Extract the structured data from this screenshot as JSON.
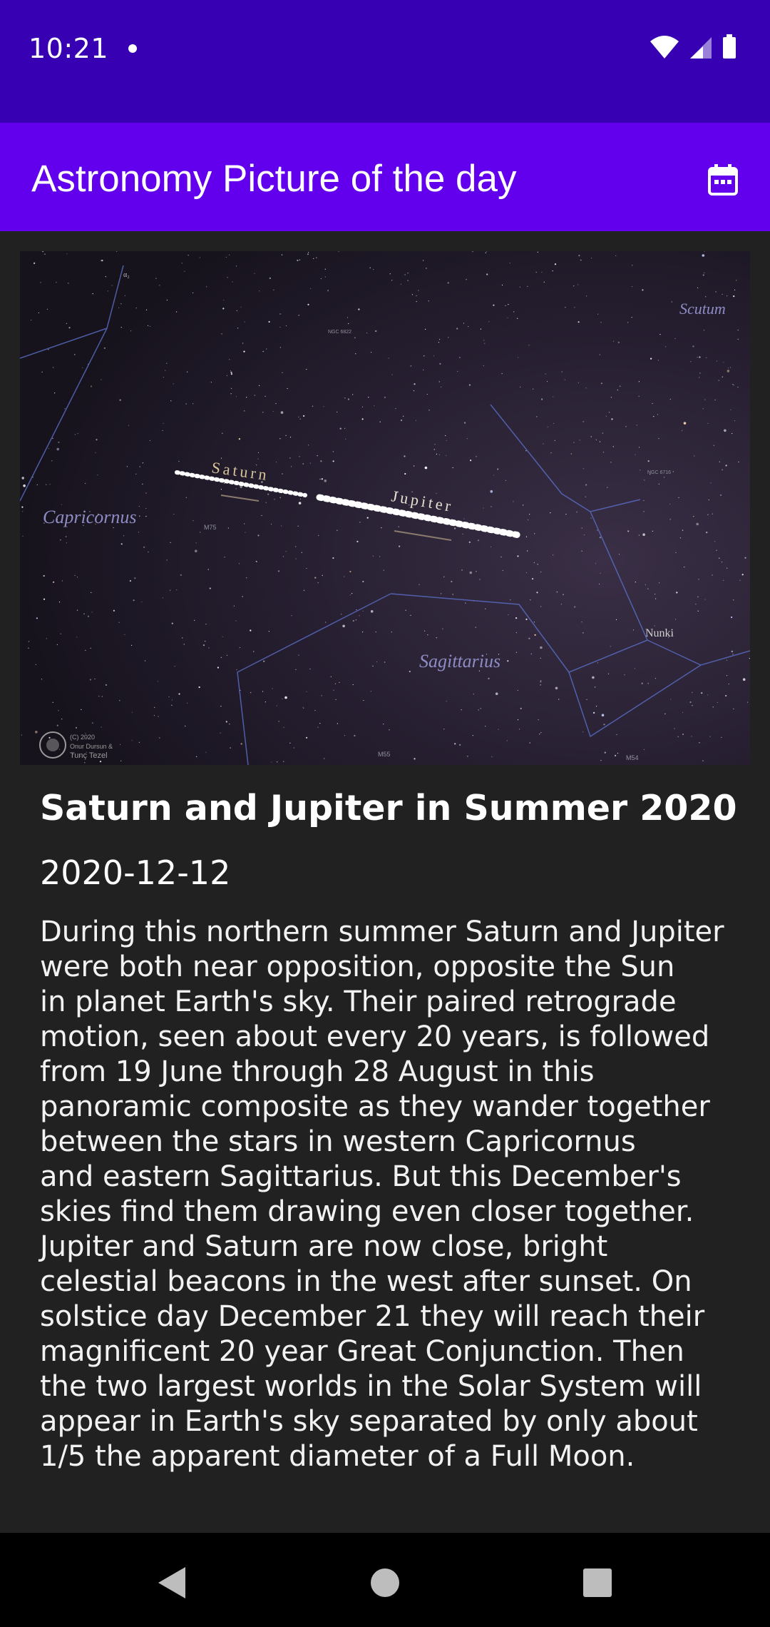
{
  "status_bar": {
    "time": "10:21",
    "icons": [
      "notification-dot-icon",
      "wifi-icon",
      "signal-icon",
      "battery-icon"
    ]
  },
  "app_bar": {
    "title": "Astronomy Picture of the day",
    "action_icon": "calendar-icon"
  },
  "apod": {
    "image_labels": {
      "saturn": "Saturn",
      "jupiter": "Jupiter",
      "capricornus": "Capricornus",
      "sagittarius": "Sagittarius",
      "scutum": "Scutum",
      "nunki": "Nunki",
      "m75": "M75",
      "m55": "M55",
      "m54": "M54",
      "ngc6822": "NGC 6822",
      "ngc6716": "NGC 6716",
      "alpha": "α₂",
      "copyright_1": "(C) 2020",
      "copyright_2": "Onur Dursun &",
      "copyright_3": "Tunç Tezel"
    },
    "title": "Saturn and Jupiter in Summer 2020",
    "date": "2020-12-12",
    "explanation": "During this northern summer Saturn and Jupiter\nwere both near opposition, opposite the Sun\nin planet Earth's sky. Their paired retrograde\nmotion, seen about every 20 years, is followed\nfrom 19 June through 28 August in this\npanoramic composite as they wander together\nbetween the stars in western Capricornus\nand eastern Sagittarius. But this December's\nskies find them drawing even closer together.\nJupiter and Saturn are now close, bright\ncelestial beacons in the west after sunset. On\nsolstice day December 21 they will reach their\nmagnificent 20 year Great Conjunction. Then\nthe two largest worlds in the Solar System will\nappear in Earth's sky separated by only about\n1/5 the apparent diameter of a Full Moon."
  },
  "nav_bar": {
    "icons": [
      "back-icon",
      "home-icon",
      "recents-icon"
    ]
  },
  "colors": {
    "status_bar": "#3700b3",
    "app_bar": "#6200ee",
    "background": "#212121",
    "nav_bar": "#000000"
  }
}
